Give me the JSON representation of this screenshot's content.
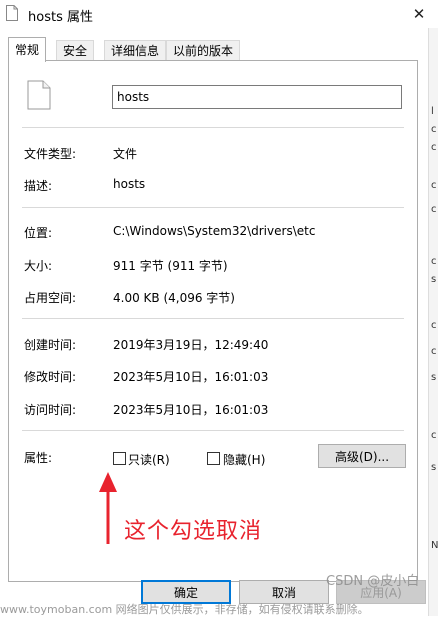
{
  "window": {
    "title": "hosts 属性",
    "close_glyph": "✕"
  },
  "tabs": [
    {
      "label": "常规",
      "active": true
    },
    {
      "label": "安全",
      "active": false
    },
    {
      "label": "详细信息",
      "active": false
    },
    {
      "label": "以前的版本",
      "active": false
    }
  ],
  "general": {
    "filename": "hosts",
    "rows": {
      "type_label": "文件类型:",
      "type_value": "文件",
      "desc_label": "描述:",
      "desc_value": "hosts",
      "location_label": "位置:",
      "location_value": "C:\\Windows\\System32\\drivers\\etc",
      "size_label": "大小:",
      "size_value": "911 字节 (911 字节)",
      "disk_label": "占用空间:",
      "disk_value": "4.00 KB (4,096 字节)",
      "created_label": "创建时间:",
      "created_value": "2019年3月19日，12:49:40",
      "modified_label": "修改时间:",
      "modified_value": "2023年5月10日，16:01:03",
      "accessed_label": "访问时间:",
      "accessed_value": "2023年5月10日，16:01:03"
    },
    "attributes": {
      "label": "属性:",
      "readonly_label": "只读(R)",
      "readonly_checked": false,
      "hidden_label": "隐藏(H)",
      "hidden_checked": false,
      "advanced_label": "高级(D)..."
    }
  },
  "annotation": {
    "text": "这个勾选取消",
    "color": "#e8232e"
  },
  "buttons": {
    "ok": "确定",
    "cancel": "取消",
    "apply": "应用(A)"
  },
  "background_glyphs": [
    "l",
    "c",
    "c",
    "c",
    "c",
    "c",
    "s",
    "c",
    "c",
    "s",
    "c",
    "s",
    "N"
  ],
  "watermarks": {
    "bottom": "www.toymoban.com 网络图片仅供展示，非存储，如有侵权请联系删除。",
    "csdn": "CSDN @皮小白"
  },
  "colors": {
    "accent": "#0078d7",
    "annotation": "#e8232e"
  }
}
